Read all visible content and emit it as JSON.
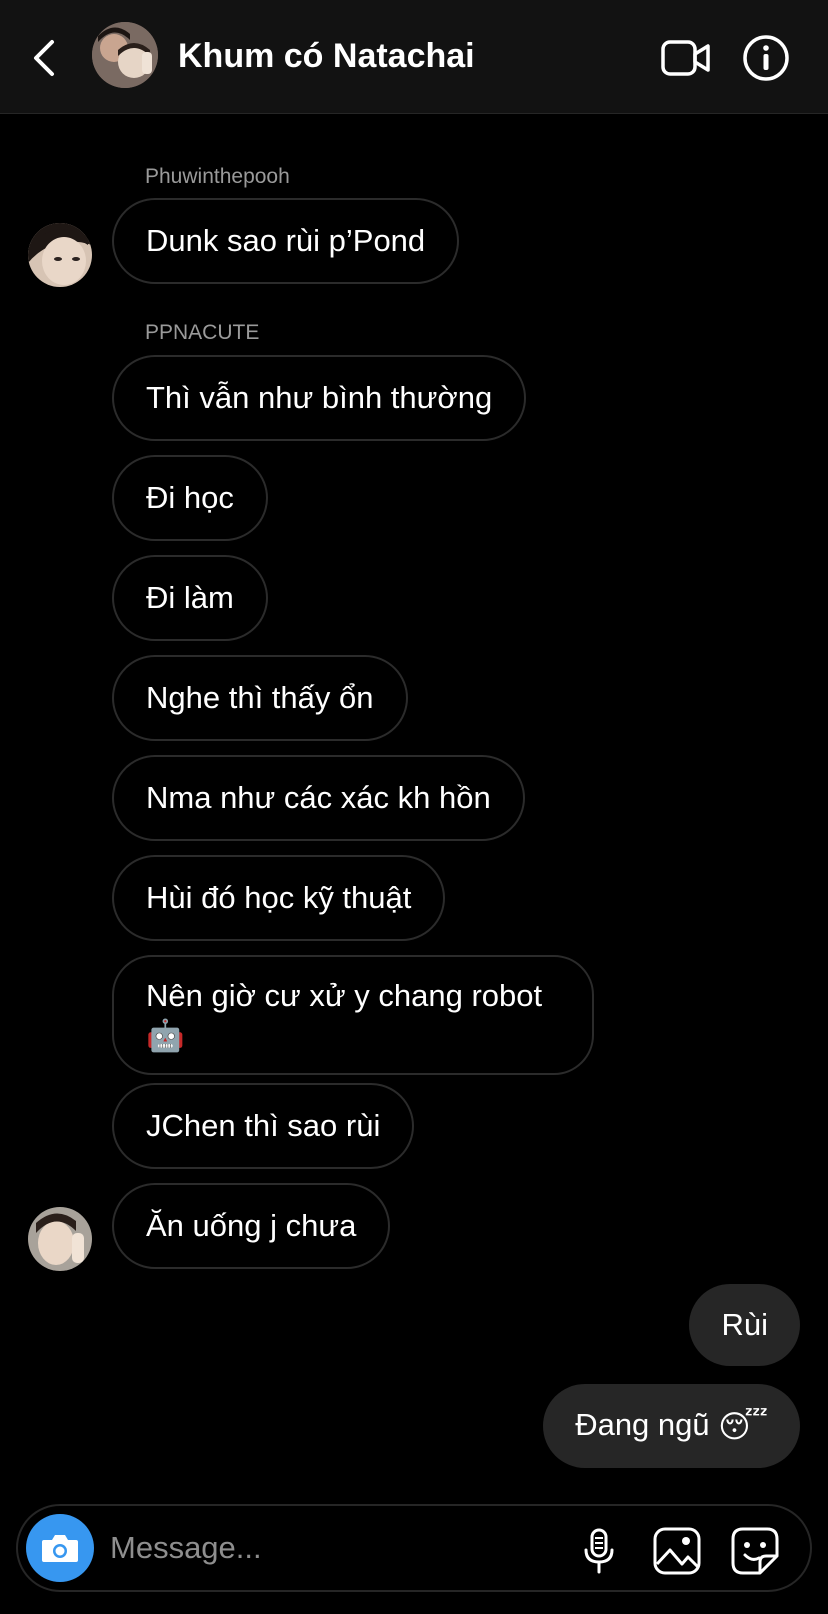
{
  "header": {
    "title": "Khum có Natachai",
    "back_icon": "chevron-left-icon",
    "video_icon": "video-camera-icon",
    "info_icon": "info-icon"
  },
  "messages": [
    {
      "sender": "Phuwinthepooh",
      "text": "Dunk sao rùi p’Pond"
    },
    {
      "sender": "PPNACUTE",
      "text": "Thì vẫn như bình thường"
    },
    {
      "text": "Đi học"
    },
    {
      "text": "Đi làm"
    },
    {
      "text": "Nghe thì thấy ổn"
    },
    {
      "text": "Nma như các xác kh hồn"
    },
    {
      "text": "Hùi đó học kỹ thuật"
    },
    {
      "text": "Nên giờ cư xử y chang robot",
      "emoji": "🤖"
    },
    {
      "text": "JChen thì sao rùi"
    },
    {
      "text": "Ăn uống j chưa"
    }
  ],
  "outgoing": [
    {
      "text": "Rùi"
    },
    {
      "text": "Đang ngũ",
      "emoji": "😴"
    }
  ],
  "composer": {
    "placeholder": "Message...",
    "camera_icon": "camera-icon",
    "mic_icon": "microphone-icon",
    "gallery_icon": "image-gallery-icon",
    "sticker_icon": "sticker-icon"
  },
  "colors": {
    "header_bg": "#121212",
    "bubble_border": "#2b2b2b",
    "outgoing_bubble": "#262626",
    "camera_button": "#3797f0"
  }
}
